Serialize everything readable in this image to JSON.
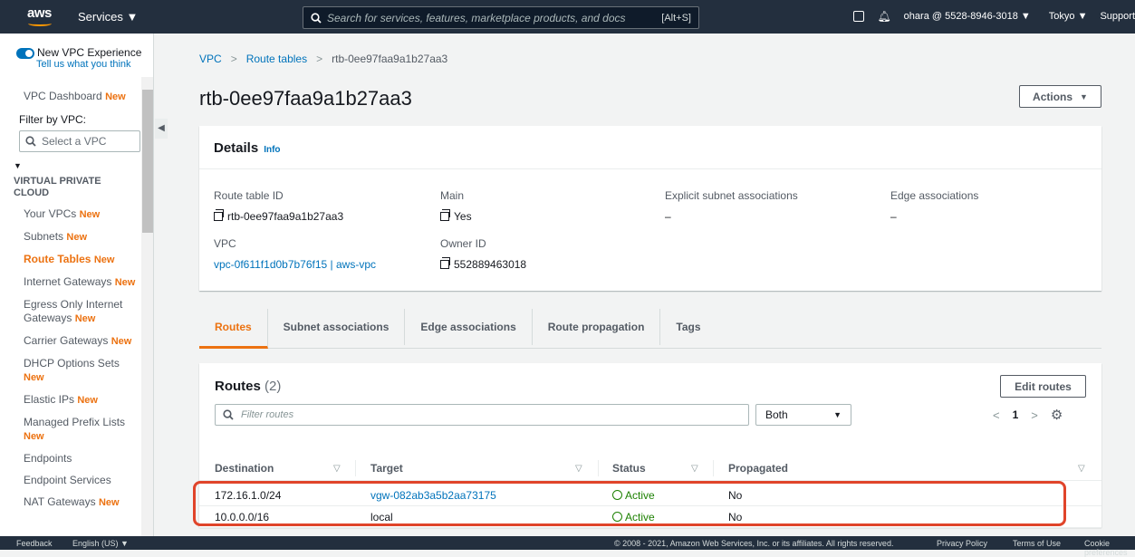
{
  "topnav": {
    "logo": "aws",
    "services_label": "Services ▼",
    "search_placeholder": "Search for services, features, marketplace products, and docs",
    "search_shortcut": "[Alt+S]",
    "account": "ohara @ 5528-8946-3018 ▼",
    "region": "Tokyo ▼",
    "support": "Support"
  },
  "sidebar": {
    "new_vpc_experience": "New VPC Experience",
    "tell_us": "Tell us what you think",
    "dashboard": "VPC Dashboard",
    "filter_label": "Filter by VPC:",
    "filter_placeholder": "Select a VPC",
    "section_title": "VIRTUAL PRIVATE CLOUD",
    "new_badge": "New",
    "items": [
      {
        "label": "Your VPCs",
        "new": true
      },
      {
        "label": "Subnets",
        "new": true
      },
      {
        "label": "Route Tables",
        "new": true,
        "active": true
      },
      {
        "label": "Internet Gateways",
        "new": true
      },
      {
        "label": "Egress Only Internet Gateways",
        "new": true
      },
      {
        "label": "Carrier Gateways",
        "new": true
      },
      {
        "label": "DHCP Options Sets",
        "new": true
      },
      {
        "label": "Elastic IPs",
        "new": true
      },
      {
        "label": "Managed Prefix Lists",
        "new": true
      },
      {
        "label": "Endpoints",
        "new": false
      },
      {
        "label": "Endpoint Services",
        "new": false
      },
      {
        "label": "NAT Gateways",
        "new": true
      }
    ]
  },
  "breadcrumb": {
    "vpc": "VPC",
    "route_tables": "Route tables",
    "current": "rtb-0ee97faa9a1b27aa3"
  },
  "page_title": "rtb-0ee97faa9a1b27aa3",
  "actions_label": "Actions",
  "details": {
    "title": "Details",
    "info": "Info",
    "route_table_id_label": "Route table ID",
    "route_table_id": "rtb-0ee97faa9a1b27aa3",
    "main_label": "Main",
    "main": "Yes",
    "explicit_label": "Explicit subnet associations",
    "explicit": "–",
    "edge_label": "Edge associations",
    "edge": "–",
    "vpc_label": "VPC",
    "vpc": "vpc-0f611f1d0b7b76f15 | aws-vpc",
    "owner_label": "Owner ID",
    "owner": "552889463018"
  },
  "tabs": [
    "Routes",
    "Subnet associations",
    "Edge associations",
    "Route propagation",
    "Tags"
  ],
  "routes": {
    "title": "Routes",
    "count": "(2)",
    "edit_label": "Edit routes",
    "filter_placeholder": "Filter routes",
    "select_value": "Both",
    "page": "1",
    "columns": [
      "Destination",
      "Target",
      "Status",
      "Propagated"
    ],
    "rows": [
      {
        "destination": "172.16.1.0/24",
        "target": "vgw-082ab3a5b2aa73175",
        "status": "Active",
        "propagated": "No"
      },
      {
        "destination": "10.0.0.0/16",
        "target": "local",
        "status": "Active",
        "propagated": "No"
      }
    ]
  },
  "footer": {
    "feedback": "Feedback",
    "language": "English (US) ▼",
    "copyright": "© 2008 - 2021, Amazon Web Services, Inc. or its affiliates. All rights reserved.",
    "privacy": "Privacy Policy",
    "terms": "Terms of Use",
    "cookies": "Cookie preferences"
  }
}
